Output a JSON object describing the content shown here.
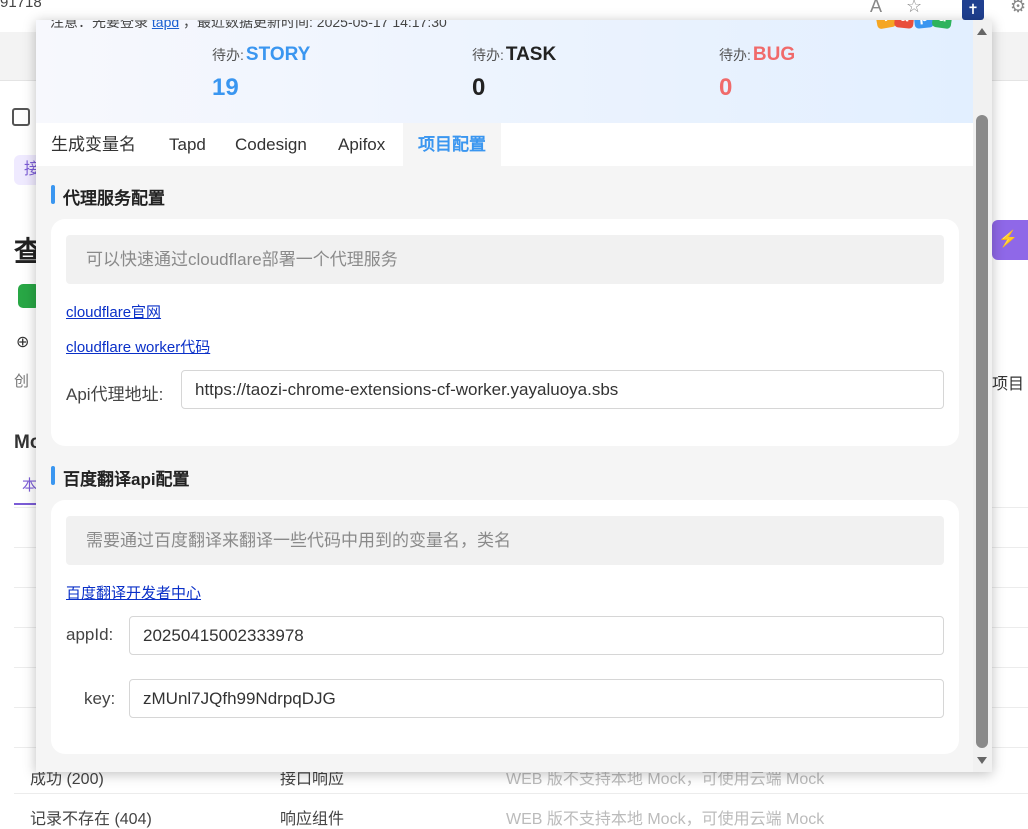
{
  "background": {
    "url_fragment": "91718",
    "big_char": "查",
    "section_char": "Mo",
    "tab_char": "本",
    "side_text": "创",
    "right_btn": "⚡ 运",
    "right_text": "项目",
    "chip": "接",
    "rows": [
      {
        "name": "成功 (200)",
        "type": "接口响应",
        "mock": "WEB 版不支持本地 Mock，可使用云端 Mock"
      },
      {
        "name": "记录不存在 (404)",
        "type": "响应组件",
        "mock": "WEB 版不支持本地 Mock，可使用云端 Mock"
      }
    ]
  },
  "popup": {
    "notice_prefix": "注意：先要登录",
    "notice_link": "tapd",
    "notice_suffix": "，最近数据更新时间: 2025-05-17 14:17:30",
    "stats": [
      {
        "label": "待办:",
        "type": "STORY",
        "value": "19"
      },
      {
        "label": "待办:",
        "type": "TASK",
        "value": "0"
      },
      {
        "label": "待办:",
        "type": "BUG",
        "value": "0"
      }
    ],
    "logo_letters": [
      "T",
      "a",
      "p",
      "d"
    ],
    "tabs": [
      "生成变量名",
      "Tapd",
      "Codesign",
      "Apifox",
      "项目配置"
    ],
    "active_tab": "项目配置",
    "proxy": {
      "title": "代理服务配置",
      "hint": "可以快速通过cloudflare部署一个代理服务",
      "link1": "cloudflare官网",
      "link2": "cloudflare worker代码",
      "api_label": "Api代理地址:",
      "api_value": "https://taozi-chrome-extensions-cf-worker.yayaluoya.sbs"
    },
    "baidu": {
      "title": "百度翻译api配置",
      "hint": "需要通过百度翻译来翻译一些代码中用到的变量名，类名",
      "link": "百度翻译开发者中心",
      "appid_label": "appId:",
      "appid_value": "20250415002333978",
      "key_label": "key:",
      "key_value": "zMUnl7JQfh99NdrpqDJG"
    }
  }
}
